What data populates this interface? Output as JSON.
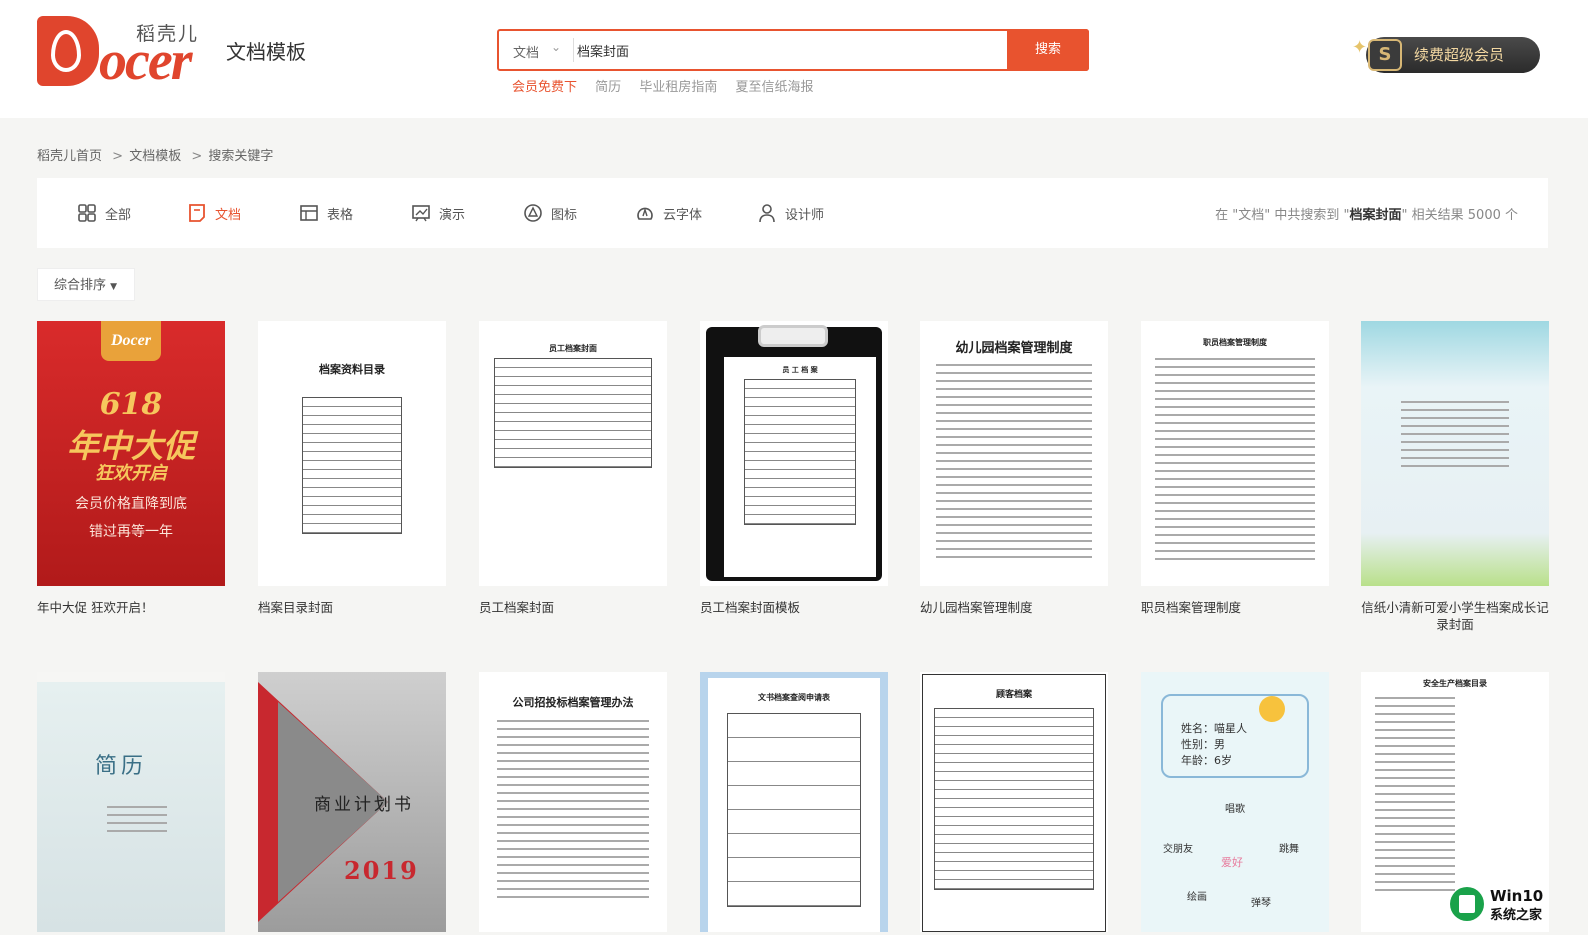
{
  "header": {
    "logo_text": "ocer",
    "logo_cn": "稻壳儿",
    "site_title": "文档模板",
    "search": {
      "type_label": "文档",
      "value": "档案封面",
      "button": "搜索"
    },
    "hot_keywords": [
      "会员免费下",
      "简历",
      "毕业租房指南",
      "夏至信纸海报"
    ],
    "vip_button": "续费超级会员"
  },
  "breadcrumb": [
    "稻壳儿首页",
    "文档模板",
    "搜索关键字"
  ],
  "tabs": [
    {
      "label": "全部",
      "icon": "grid-icon"
    },
    {
      "label": "文档",
      "icon": "document-icon"
    },
    {
      "label": "表格",
      "icon": "table-icon"
    },
    {
      "label": "演示",
      "icon": "presentation-icon"
    },
    {
      "label": "图标",
      "icon": "shape-icon"
    },
    {
      "label": "云字体",
      "icon": "font-icon"
    },
    {
      "label": "设计师",
      "icon": "user-icon"
    }
  ],
  "active_tab": "文档",
  "result_note": {
    "prefix": "在 \"文档\" 中共搜索到 \"",
    "keyword": "档案封面",
    "suffix": "\" 相关结果 5000 个"
  },
  "sort_label": "综合排序",
  "cards_row1": [
    {
      "caption": "年中大促 狂欢开启！"
    },
    {
      "caption": "档案目录封面"
    },
    {
      "caption": "员工档案封面"
    },
    {
      "caption": "员工档案封面模板"
    },
    {
      "caption": "幼儿园档案管理制度"
    },
    {
      "caption": "职员档案管理制度"
    },
    {
      "caption": "信纸小清新可爱小学生档案成长记录封面"
    }
  ],
  "thumb_text": {
    "promo_big": "618",
    "promo_line1": "年中大促",
    "promo_line2": "狂欢开启",
    "promo_sub": "会员价格直降到底",
    "promo_sub2": "错过再等一年",
    "t2_title": "档案资料目录",
    "t3_title": "员工档案封面",
    "t4_title": "员 工 档 案",
    "t5_title": "幼儿园档案管理制度",
    "t6_title": "职员档案管理制度",
    "r2_resume": "简历",
    "r2_business": "商业计划书",
    "r2_year": "2019",
    "r2_company": "公司招投标档案管理办法",
    "r2_apply": "文书档案查阅申请表",
    "r2_customer": "顾客档案",
    "r2_name": "姓名：喵星人",
    "r2_gender": "性别：男",
    "r2_age": "年龄：6岁",
    "r2_hobby": "爱好",
    "r2_sing": "唱歌",
    "r2_dance": "跳舞",
    "r2_friend": "交朋友",
    "r2_draw": "绘画",
    "r2_piano": "弹琴",
    "r2_safety": "安全生产档案目录"
  },
  "watermark": {
    "line1": "Win10",
    "line2": "系统之家"
  },
  "colors": {
    "accent": "#e8532f",
    "brand_red": "#e0452d",
    "vip_gold": "#f2d7a1"
  }
}
